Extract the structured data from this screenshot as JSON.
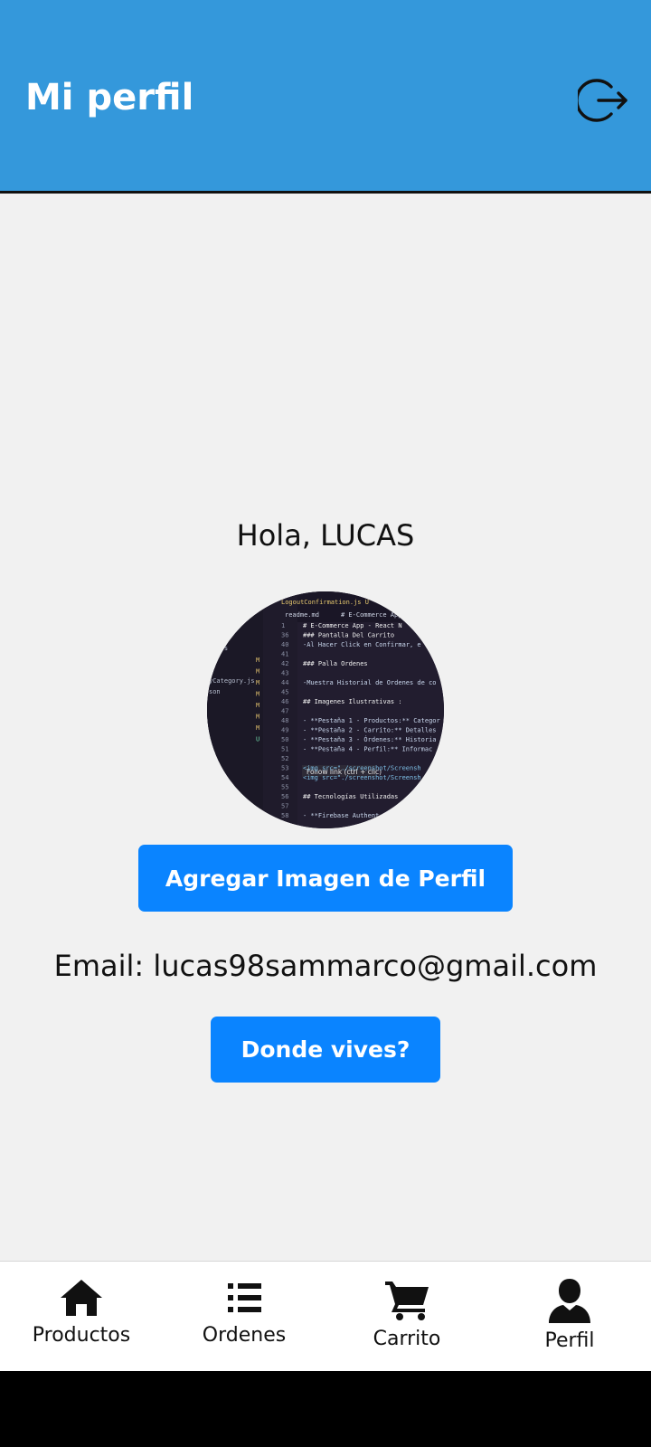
{
  "header": {
    "title": "Mi perfil",
    "logout_icon": "logout-icon"
  },
  "profile": {
    "greeting": "Hola, LUCAS",
    "add_image_label": "Agregar Imagen de Perfil",
    "email_text": "Email: lucas98sammarco@gmail.com",
    "where_label": "Donde vives?"
  },
  "avatar_photo": {
    "tabs": [
      "LogoutConfirmation.js U",
      "readme.md",
      "# E-Commerce App"
    ],
    "line_numbers": [
      "1",
      "36",
      "40",
      "41",
      "42",
      "43",
      "44",
      "45",
      "46",
      "47",
      "48",
      "49",
      "50",
      "51",
      "52",
      "53",
      "54",
      "55",
      "56",
      "57",
      "58"
    ],
    "code_lines": [
      "# E-Commerce App - React N",
      "### Pantalla Del Carrito",
      "-Al Hacer Click en Confirmar, e",
      "",
      "### Palla Ordenes",
      "",
      "-Muestra Historial de Ordenes de co",
      "",
      "## Imagenes Ilustrativas :",
      "",
      "- **Pestaña 1 - Productos:** Categor",
      "- **Pestaña 2 - Carrito:** Detalles",
      "- **Pestaña 3 - Órdenes:** Historia",
      "- **Pestaña 4 - Perfil:** Informac",
      "",
      "<img src=\"./screenshot/Screensh",
      "<img src=\"./screenshot/Screensh",
      "",
      "## Tecnologías Utilizadas",
      "",
      "- **Firebase Authent"
    ],
    "tooltip": "Follow link (ctrl + clic)",
    "sidebar_files": [
      "ailjs",
      "yCategory.js",
      "son"
    ],
    "git_marks": [
      "M",
      "M",
      "M",
      "M",
      "M",
      "M",
      "M",
      "U"
    ]
  },
  "nav": {
    "items": [
      {
        "label": "Productos",
        "icon": "home-icon"
      },
      {
        "label": "Ordenes",
        "icon": "list-icon"
      },
      {
        "label": "Carrito",
        "icon": "cart-icon"
      },
      {
        "label": "Perfil",
        "icon": "person-icon"
      }
    ]
  },
  "colors": {
    "header_bg": "#3498db",
    "button_bg": "#0a84ff",
    "page_bg": "#f1f1f1",
    "code_bg": "#221d2f"
  }
}
